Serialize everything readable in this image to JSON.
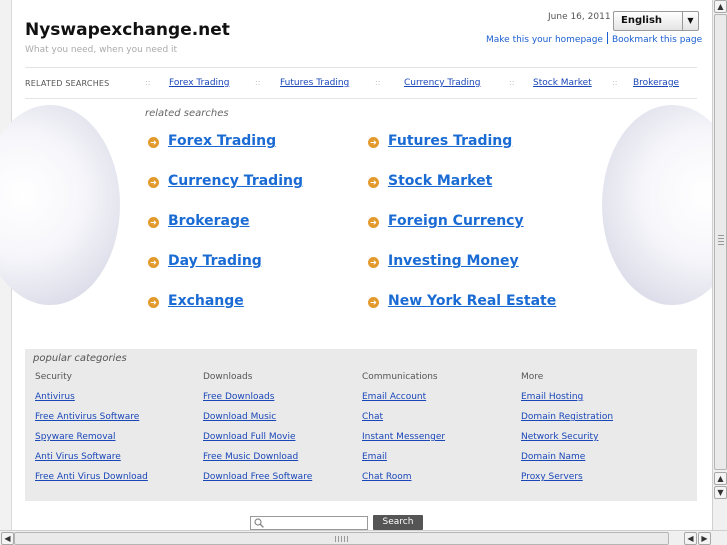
{
  "header": {
    "site_title": "Nyswapexchange.net",
    "tagline": "What you need, when you need it",
    "date": "June 16, 2011",
    "language": "English",
    "make_homepage": "Make this your homepage",
    "bookmark": "Bookmark this page"
  },
  "related_bar": {
    "title": "RELATED SEARCHES",
    "separator": "::",
    "items": [
      "Forex Trading",
      "Futures Trading",
      "Currency Trading",
      "Stock Market",
      "Brokerage"
    ]
  },
  "related": {
    "label": "related searches",
    "left": [
      "Forex Trading",
      "Currency Trading",
      "Brokerage",
      "Day Trading",
      "Exchange"
    ],
    "right": [
      "Futures Trading",
      "Stock Market",
      "Foreign Currency",
      "Investing Money",
      "New York Real Estate"
    ]
  },
  "popular": {
    "title": "popular categories",
    "columns": [
      {
        "heading": "Security",
        "links": [
          "Antivirus",
          "Free Antivirus Software",
          "Spyware Removal",
          "Anti Virus Software",
          "Free Anti Virus Download"
        ]
      },
      {
        "heading": "Downloads",
        "links": [
          "Free Downloads",
          "Download Music",
          "Download Full Movie",
          "Free Music Download",
          "Download Free Software"
        ]
      },
      {
        "heading": "Communications",
        "links": [
          "Email Account",
          "Chat",
          "Instant Messenger",
          "Email",
          "Chat Room"
        ]
      },
      {
        "heading": "More",
        "links": [
          "Email Hosting",
          "Domain Registration",
          "Network Security",
          "Domain Name",
          "Proxy Servers"
        ]
      }
    ]
  },
  "search": {
    "placeholder": "",
    "button": "Search"
  },
  "colors": {
    "link": "#1a6bd4",
    "arrow": "#e39a2d",
    "popular_bg": "#eaeaea"
  }
}
